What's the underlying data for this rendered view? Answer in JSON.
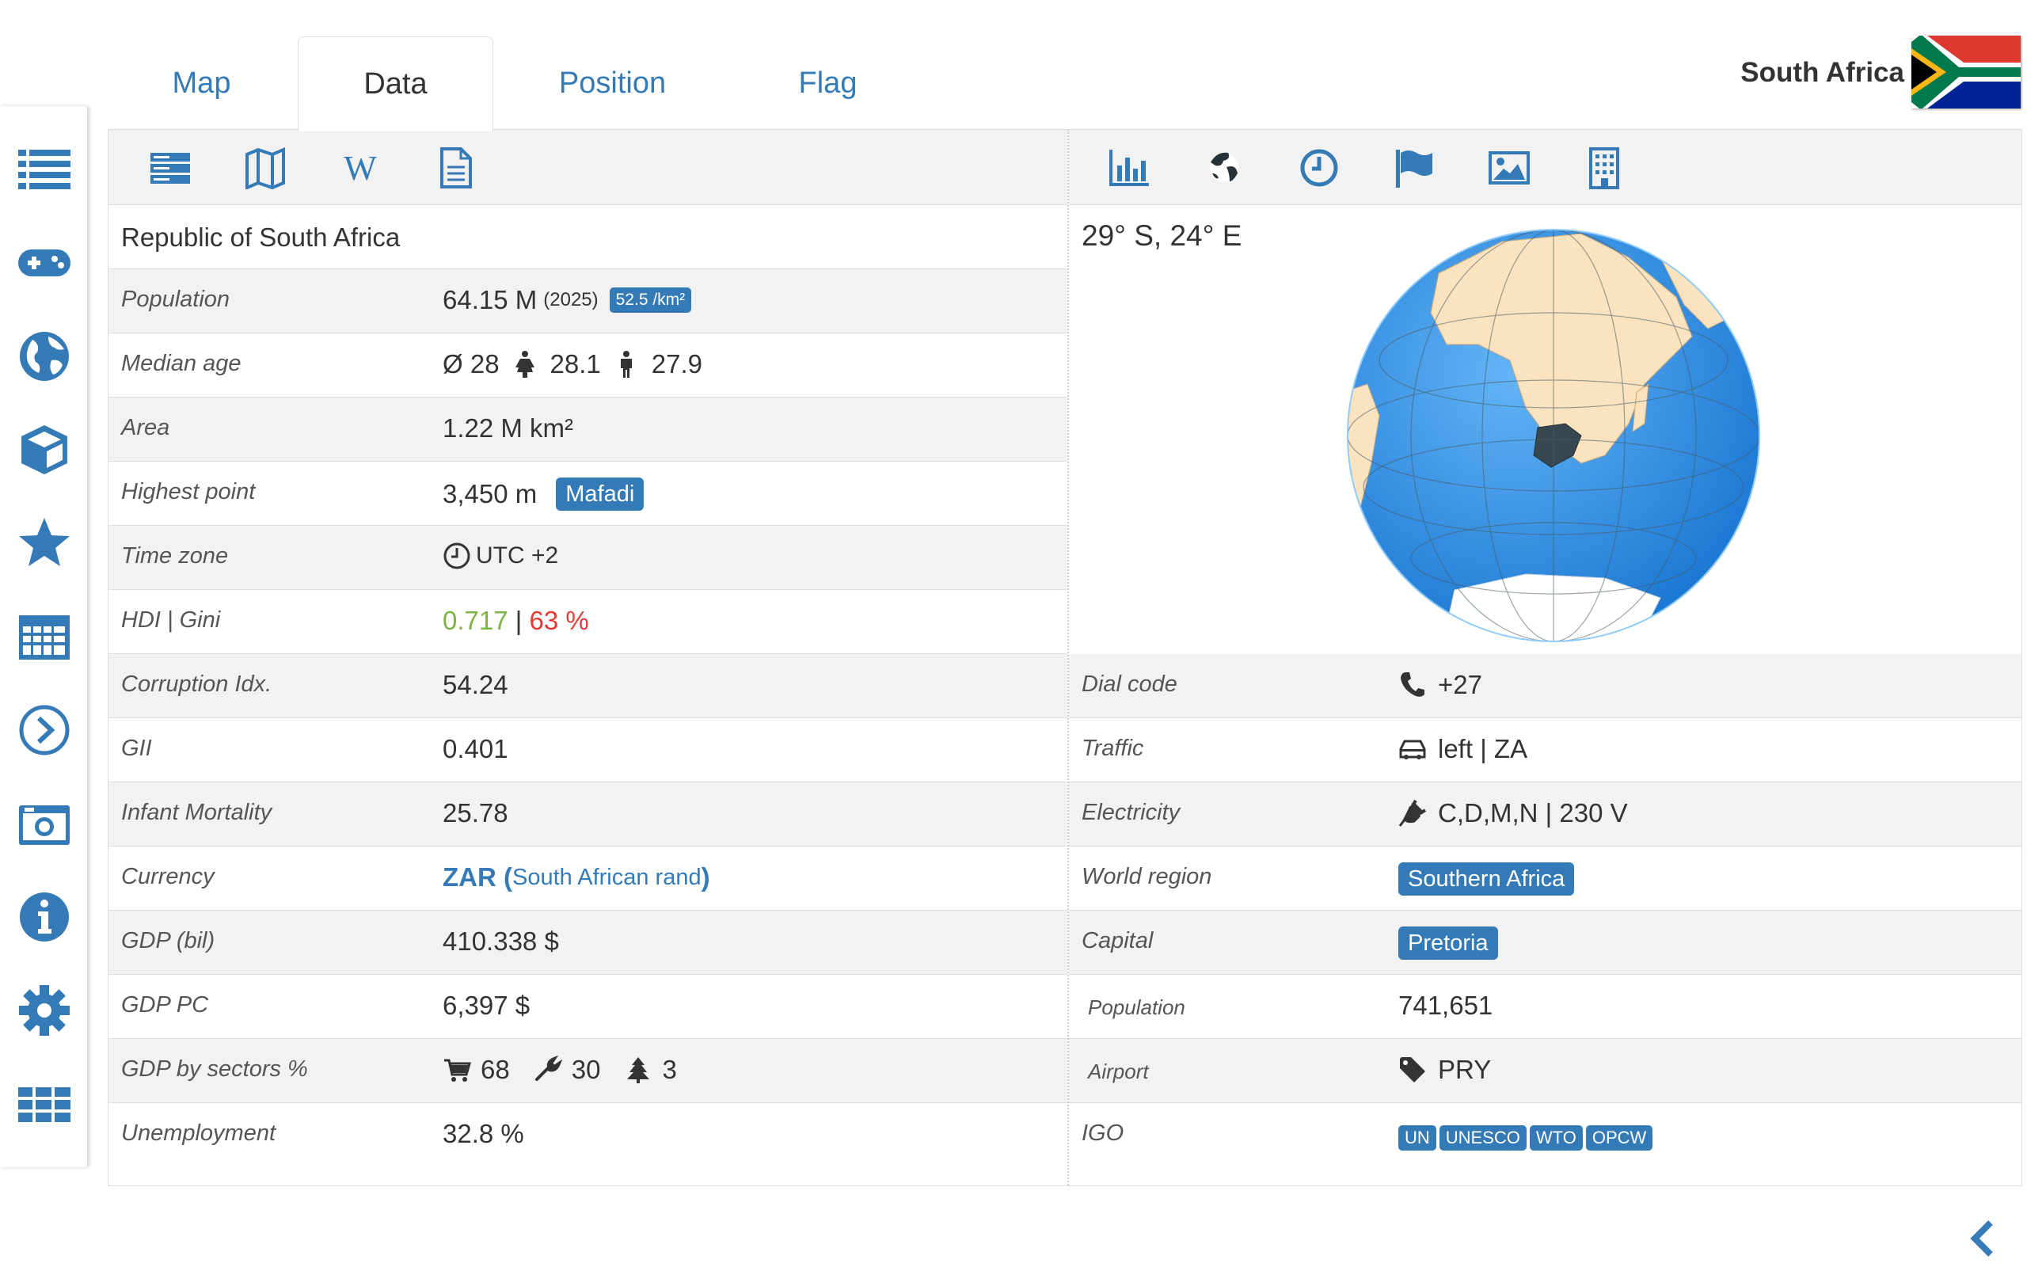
{
  "tabs": [
    {
      "label": "Map",
      "active": false
    },
    {
      "label": "Data",
      "active": true
    },
    {
      "label": "Position",
      "active": false
    },
    {
      "label": "Flag",
      "active": false
    }
  ],
  "country": {
    "name": "South Africa"
  },
  "sidebar": {
    "icons": [
      "list-icon",
      "gamepad-icon",
      "globe-icon",
      "cube-icon",
      "star-icon",
      "calendar-icon",
      "chevron-circle-icon",
      "camera-icon",
      "info-icon",
      "gear-icon",
      "grid-icon"
    ]
  },
  "toolbar_left": [
    "server-icon",
    "map-icon",
    "wikipedia-icon",
    "document-icon"
  ],
  "toolbar_right": [
    "bar-chart-icon",
    "globe-icon",
    "clock-icon",
    "flag-icon",
    "image-icon",
    "building-icon"
  ],
  "left": {
    "official_name": "Republic of South Africa",
    "population": {
      "label": "Population",
      "value": "64.15 M",
      "year": "(2025)",
      "density": "52.5 /km²"
    },
    "median_age": {
      "label": "Median age",
      "total": "Ø 28",
      "female": "28.1",
      "male": "27.9"
    },
    "area": {
      "label": "Area",
      "value": "1.22 M km²"
    },
    "highest_point": {
      "label": "Highest point",
      "value": "3,450 m",
      "name": "Mafadi"
    },
    "time_zone": {
      "label": "Time zone",
      "value": "UTC +2"
    },
    "hdi_gini": {
      "label": "HDI | Gini",
      "hdi": "0.717",
      "sep": " | ",
      "gini": "63 %"
    },
    "corruption": {
      "label": "Corruption Idx.",
      "value": "54.24"
    },
    "gii": {
      "label": "GII",
      "value": "0.401"
    },
    "infant_mortality": {
      "label": "Infant Mortality",
      "value": "25.78"
    },
    "currency": {
      "label": "Currency",
      "code": "ZAR",
      "open": " (",
      "name": "South African rand",
      "close": ")"
    },
    "gdp": {
      "label": "GDP (bil)",
      "value": "410.338 $"
    },
    "gdp_pc": {
      "label": "GDP PC",
      "value": "6,397 $"
    },
    "gdp_sectors": {
      "label": "GDP by sectors %",
      "services": "68",
      "industry": "30",
      "agriculture": "3"
    },
    "unemployment": {
      "label": "Unemployment",
      "value": "32.8 %"
    }
  },
  "right": {
    "coordinates": "29° S, 24° E",
    "dial_code": {
      "label": "Dial code",
      "value": "+27"
    },
    "traffic": {
      "label": "Traffic",
      "value": "left | ZA"
    },
    "electricity": {
      "label": "Electricity",
      "value": "C,D,M,N | 230 V"
    },
    "world_region": {
      "label": "World region",
      "value": "Southern Africa"
    },
    "capital": {
      "label": "Capital",
      "value": "Pretoria"
    },
    "capital_population": {
      "label": "Population",
      "value": "741,651"
    },
    "airport": {
      "label": "Airport",
      "value": "PRY"
    },
    "igo": {
      "label": "IGO",
      "items": [
        "UN",
        "UNESCO",
        "WTO",
        "OPCW"
      ]
    }
  },
  "colors": {
    "accent": "#337ab7",
    "hdi": "#7cb342",
    "gini": "#e53935",
    "ocean": "#1e88e5",
    "land": "#fbe3bf",
    "highlight": "#37474f"
  }
}
